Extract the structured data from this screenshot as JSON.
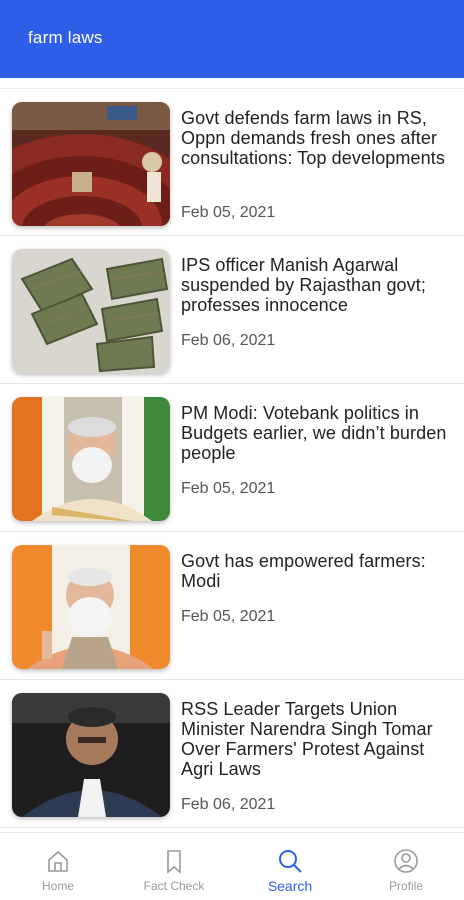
{
  "app_bar": {
    "title": "farm laws"
  },
  "articles": [
    {
      "headline": "Govt defends farm laws in RS, Oppn demands fresh ones after consultations: Top developments",
      "date": "Feb 05, 2021"
    },
    {
      "headline": "IPS officer Manish Agarwal suspended by Rajasthan govt; professes innocence",
      "date": "Feb 06, 2021"
    },
    {
      "headline": "PM Modi: Votebank politics in Budgets earlier, we didn’t burden people",
      "date": "Feb 05, 2021"
    },
    {
      "headline": "Govt has empowered farmers: Modi",
      "date": "Feb 05, 2021"
    },
    {
      "headline": "RSS Leader Targets Union Minister Narendra Singh Tomar Over Farmers' Protest Against Agri Laws",
      "date": "Feb 06, 2021"
    }
  ],
  "bottom_nav": {
    "active": "Search",
    "items": [
      {
        "label": "Home",
        "icon": "home-icon"
      },
      {
        "label": "Fact Check",
        "icon": "bookmark-icon"
      },
      {
        "label": "Search",
        "icon": "search-icon"
      },
      {
        "label": "Profile",
        "icon": "profile-icon"
      }
    ]
  },
  "colors": {
    "accent": "#2f5fe8",
    "text": "#222222",
    "muted": "#9a9a9a"
  }
}
